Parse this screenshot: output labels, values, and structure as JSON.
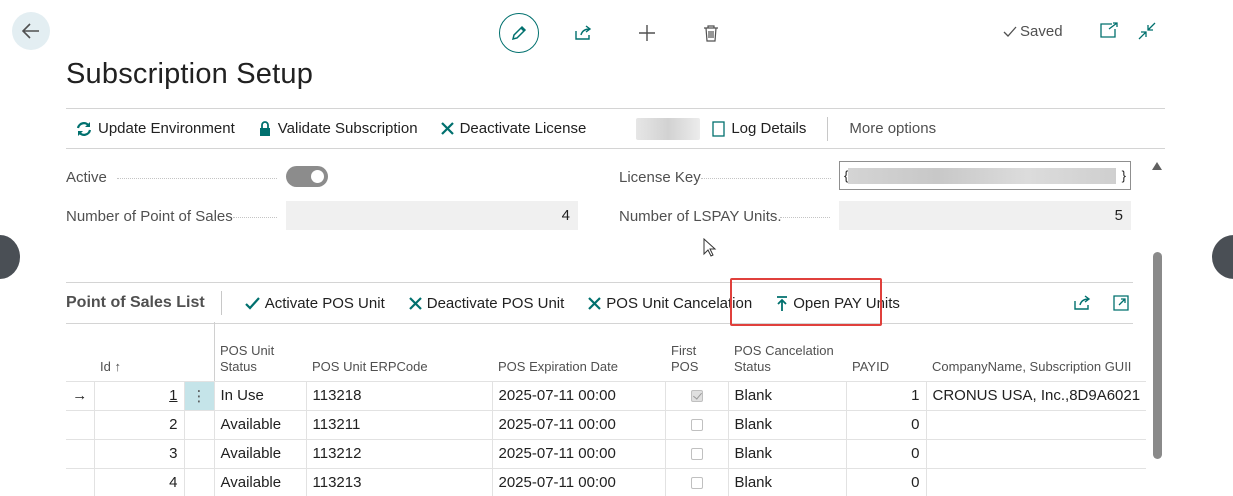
{
  "page": {
    "title": "Subscription Setup"
  },
  "top": {
    "saved_label": "Saved"
  },
  "actions": {
    "update_environment": "Update Environment",
    "validate_subscription": "Validate Subscription",
    "deactivate_license": "Deactivate License",
    "log_details": "Log Details",
    "more_options": "More options"
  },
  "fields": {
    "active_label": "Active",
    "active_value": true,
    "num_pos_label": "Number of Point of Sales",
    "num_pos_value": "4",
    "license_key_label": "License Key",
    "license_key_open": "{",
    "license_key_close": "}",
    "num_lspay_label": "Number of LSPAY Units.",
    "num_lspay_value": "5"
  },
  "list": {
    "title": "Point of Sales List",
    "activate": "Activate POS Unit",
    "deactivate": "Deactivate POS Unit",
    "cancelation": "POS Unit Cancelation",
    "open_pay": "Open PAY Units",
    "columns": {
      "id": "Id",
      "id_sort": "↑",
      "status_1": "POS Unit",
      "status_2": "Status",
      "erp": "POS Unit ERPCode",
      "expiration": "POS Expiration Date",
      "first_1": "First",
      "first_2": "POS",
      "cancel_1": "POS Cancelation",
      "cancel_2": "Status",
      "payid": "PAYID",
      "company": "CompanyName, Subscription GUII"
    },
    "rows": [
      {
        "id": "1",
        "status": "In Use",
        "erp": "113218",
        "expiration": "2025-07-11 00:00",
        "first": true,
        "cancel": "Blank",
        "payid": "1",
        "company": "CRONUS USA, Inc.,8D9A6021"
      },
      {
        "id": "2",
        "status": "Available",
        "erp": "113211",
        "expiration": "2025-07-11 00:00",
        "first": false,
        "cancel": "Blank",
        "payid": "0",
        "company": ""
      },
      {
        "id": "3",
        "status": "Available",
        "erp": "113212",
        "expiration": "2025-07-11 00:00",
        "first": false,
        "cancel": "Blank",
        "payid": "0",
        "company": ""
      },
      {
        "id": "4",
        "status": "Available",
        "erp": "113213",
        "expiration": "2025-07-11 00:00",
        "first": false,
        "cancel": "Blank",
        "payid": "0",
        "company": ""
      }
    ]
  },
  "colors": {
    "accent": "#00706e",
    "highlight": "#e0403c"
  }
}
